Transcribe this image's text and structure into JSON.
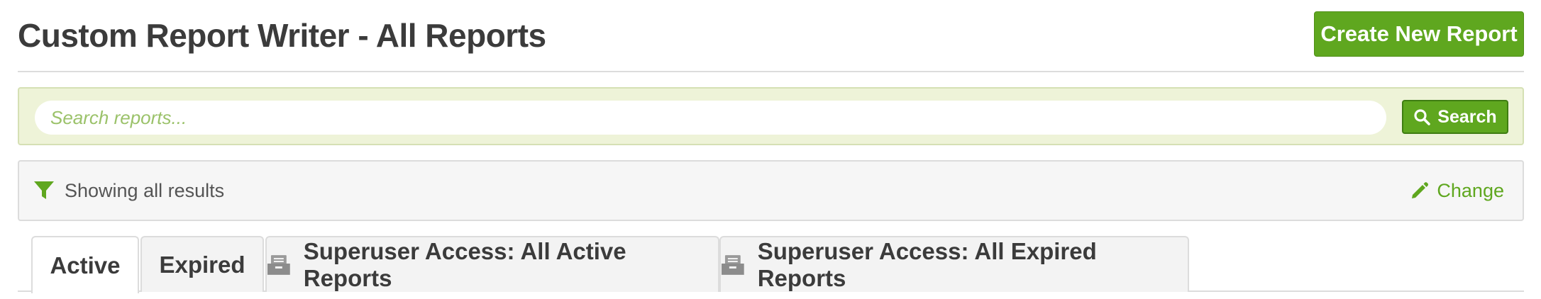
{
  "header": {
    "title": "Custom Report Writer - All Reports",
    "create_button_label": "Create New Report"
  },
  "search": {
    "placeholder": "Search reports...",
    "value": "",
    "button_label": "Search"
  },
  "filter": {
    "status_text": "Showing all results",
    "change_label": "Change"
  },
  "tabs": [
    {
      "label": "Active",
      "active": true,
      "icon": null
    },
    {
      "label": "Expired",
      "active": false,
      "icon": null
    },
    {
      "label": "Superuser Access: All Active Reports",
      "active": false,
      "icon": "archive-box-icon"
    },
    {
      "label": "Superuser Access: All Expired Reports",
      "active": false,
      "icon": "archive-box-icon"
    }
  ],
  "colors": {
    "accent": "#5fa71f",
    "search_panel_bg": "#eef3d8",
    "filter_bar_bg": "#f6f6f6",
    "title_text": "#3b3b3b"
  }
}
